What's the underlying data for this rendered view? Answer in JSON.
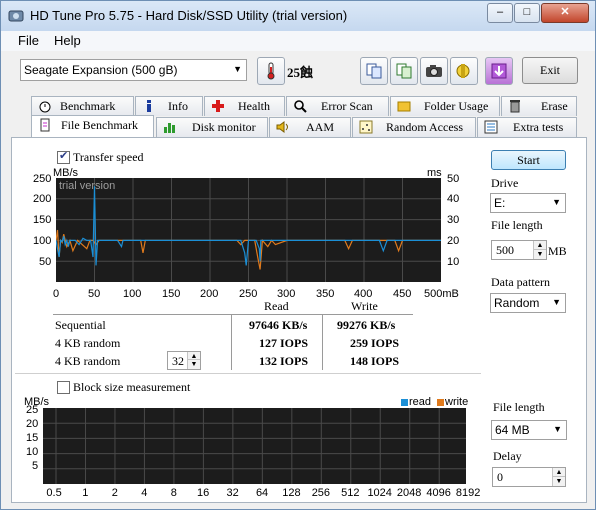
{
  "window": {
    "title": "HD Tune Pro 5.75 - Hard Disk/SSD Utility (trial version)"
  },
  "menu": {
    "file": "File",
    "help": "Help"
  },
  "toolbar": {
    "drive_select": "Seagate Expansion (500 gB)",
    "temperature": "25蝕",
    "exit_label": "Exit"
  },
  "tabs_top": [
    "Benchmark",
    "Info",
    "Health",
    "Error Scan",
    "Folder Usage",
    "Erase"
  ],
  "tabs_bottom": [
    "File Benchmark",
    "Disk monitor",
    "AAM",
    "Random Access",
    "Extra tests"
  ],
  "transfer": {
    "checkbox_label": "Transfer speed",
    "watermark": "trial version",
    "left_unit": "MB/s",
    "right_unit": "ms"
  },
  "side": {
    "start_label": "Start",
    "drive_label": "Drive",
    "drive_value": "E:",
    "file_length_label": "File length",
    "file_length_value": "500",
    "file_length_unit": "MB",
    "data_pattern_label": "Data pattern",
    "data_pattern_value": "Random",
    "file_length2_label": "File length",
    "file_length2_value": "64 MB",
    "delay_label": "Delay",
    "delay_value": "0"
  },
  "results": {
    "col_read": "Read",
    "col_write": "Write",
    "rows": [
      {
        "label": "Sequential",
        "read": "97646 KB/s",
        "write": "99276 KB/s"
      },
      {
        "label": "4 KB random",
        "read": "127 IOPS",
        "write": "259 IOPS"
      },
      {
        "label": "4 KB random",
        "read": "132 IOPS",
        "write": "148 IOPS"
      }
    ],
    "queue_depth": "32"
  },
  "block": {
    "checkbox_label": "Block size measurement",
    "unit": "MB/s",
    "legend_read": "read",
    "legend_write": "write"
  },
  "colors": {
    "read": "#1b8fd6",
    "write": "#e07a1c",
    "chart_bg": "#1c1c1c",
    "grid": "#4a4a4a"
  },
  "chart_data": [
    {
      "type": "line",
      "title": "",
      "xlabel": "",
      "ylabel": "MB/s",
      "x_ticks": [
        "0",
        "50",
        "100",
        "150",
        "200",
        "250",
        "300",
        "350",
        "400",
        "450",
        "500mB"
      ],
      "y_ticks_left": [
        "250",
        "200",
        "150",
        "100",
        "50"
      ],
      "y_ticks_right": [
        "50",
        "40",
        "30",
        "20",
        "10"
      ],
      "xlim": [
        0,
        500
      ],
      "ylim": [
        0,
        250
      ],
      "y2lim": [
        0,
        50
      ],
      "series": [
        {
          "name": "read",
          "x": [
            0,
            2,
            4,
            6,
            8,
            10,
            12,
            14,
            16,
            18,
            20,
            25,
            30,
            35,
            40,
            45,
            48,
            50,
            52,
            54,
            56,
            60,
            80,
            85,
            87,
            90,
            100,
            200,
            240,
            245,
            247,
            250,
            255,
            260,
            264,
            265,
            266,
            270,
            300,
            310,
            350,
            360,
            400,
            420,
            425,
            430,
            450,
            470,
            500
          ],
          "y": [
            100,
            80,
            60,
            100,
            97,
            110,
            90,
            100,
            85,
            100,
            100,
            100,
            90,
            105,
            100,
            100,
            60,
            230,
            40,
            100,
            100,
            100,
            100,
            85,
            100,
            100,
            100,
            100,
            100,
            70,
            40,
            100,
            100,
            100,
            80,
            50,
            100,
            100,
            100,
            100,
            100,
            100,
            100,
            100,
            75,
            100,
            100,
            100,
            100
          ]
        },
        {
          "name": "write",
          "x": [
            0,
            2,
            4,
            6,
            8,
            10,
            14,
            18,
            22,
            28,
            34,
            40,
            44,
            48,
            52,
            56,
            60,
            80,
            100,
            110,
            113,
            116,
            120,
            200,
            235,
            240,
            245,
            250,
            258,
            262,
            265,
            268,
            275,
            280,
            285,
            300,
            330,
            375,
            380,
            385,
            400,
            440,
            445,
            450,
            460,
            500
          ],
          "y": [
            100,
            125,
            60,
            100,
            95,
            115,
            85,
            100,
            75,
            100,
            90,
            80,
            100,
            100,
            90,
            100,
            100,
            100,
            100,
            100,
            70,
            100,
            100,
            100,
            100,
            90,
            100,
            100,
            100,
            60,
            30,
            100,
            85,
            100,
            90,
            100,
            100,
            100,
            80,
            100,
            100,
            100,
            75,
            100,
            100,
            100
          ]
        }
      ]
    },
    {
      "type": "bar",
      "title": "",
      "xlabel": "",
      "ylabel": "MB/s",
      "categories": [
        "0.5",
        "1",
        "2",
        "4",
        "8",
        "16",
        "32",
        "64",
        "128",
        "256",
        "512",
        "1024",
        "2048",
        "4096",
        "8192"
      ],
      "y_ticks": [
        "25",
        "20",
        "15",
        "10",
        "5"
      ],
      "ylim": [
        0,
        25
      ],
      "series": [
        {
          "name": "read",
          "values": []
        },
        {
          "name": "write",
          "values": []
        }
      ]
    }
  ]
}
